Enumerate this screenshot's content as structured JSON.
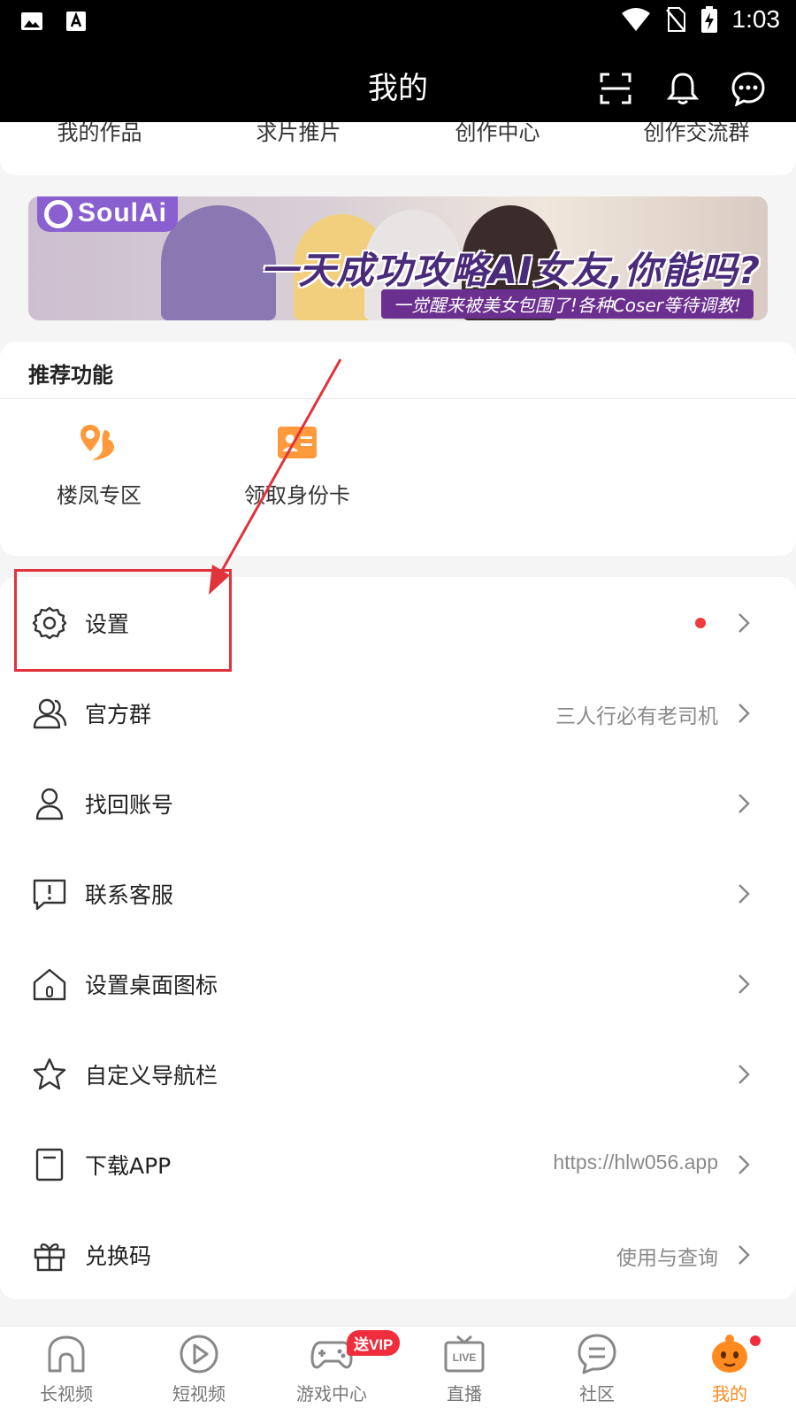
{
  "status_bar": {
    "time": "1:03",
    "icons": [
      "image-icon",
      "text-a-icon",
      "wifi-icon",
      "no-sim-icon",
      "battery-charging-icon"
    ]
  },
  "header": {
    "title": "我的",
    "icons": [
      "scan-icon",
      "bell-icon",
      "message-icon"
    ]
  },
  "quick_links": [
    "我的作品",
    "求片推片",
    "创作中心",
    "创作交流群"
  ],
  "banner": {
    "logo": "SoulAi",
    "headline": "一天成功攻略AI女友,你能吗?",
    "subline": "一觉醒来被美女包围了!各种Coser等待调教!"
  },
  "recommend": {
    "title": "推荐功能",
    "items": [
      {
        "label": "楼凤专区",
        "icon": "location-pin-icon"
      },
      {
        "label": "领取身份卡",
        "icon": "id-card-icon"
      }
    ]
  },
  "menu": [
    {
      "label": "设置",
      "value": "",
      "icon": "gear-icon",
      "dot": true
    },
    {
      "label": "官方群",
      "value": "三人行必有老司机",
      "icon": "group-icon"
    },
    {
      "label": "找回账号",
      "value": "",
      "icon": "user-icon"
    },
    {
      "label": "联系客服",
      "value": "",
      "icon": "chat-alert-icon"
    },
    {
      "label": "设置桌面图标",
      "value": "",
      "icon": "home-icon"
    },
    {
      "label": "自定义导航栏",
      "value": "",
      "icon": "star-icon"
    },
    {
      "label": "下载APP",
      "value": "https://hlw056.app",
      "icon": "document-icon"
    },
    {
      "label": "兑换码",
      "value": "使用与查询",
      "icon": "gift-icon"
    }
  ],
  "bottom_nav": {
    "items": [
      {
        "label": "长视频",
        "icon": "home-tab-icon"
      },
      {
        "label": "短视频",
        "icon": "play-tab-icon"
      },
      {
        "label": "游戏中心",
        "icon": "gamepad-icon"
      },
      {
        "label": "直播",
        "icon": "live-tv-icon"
      },
      {
        "label": "社区",
        "icon": "community-icon"
      },
      {
        "label": "我的",
        "icon": "mine-mascot-icon"
      }
    ],
    "vip_badge": "送VIP",
    "live_text": "LIVE",
    "active_index": 5
  },
  "colors": {
    "accent": "#ff8a1f",
    "annotation": "#e0333b",
    "badge": "#ef2d3d"
  }
}
